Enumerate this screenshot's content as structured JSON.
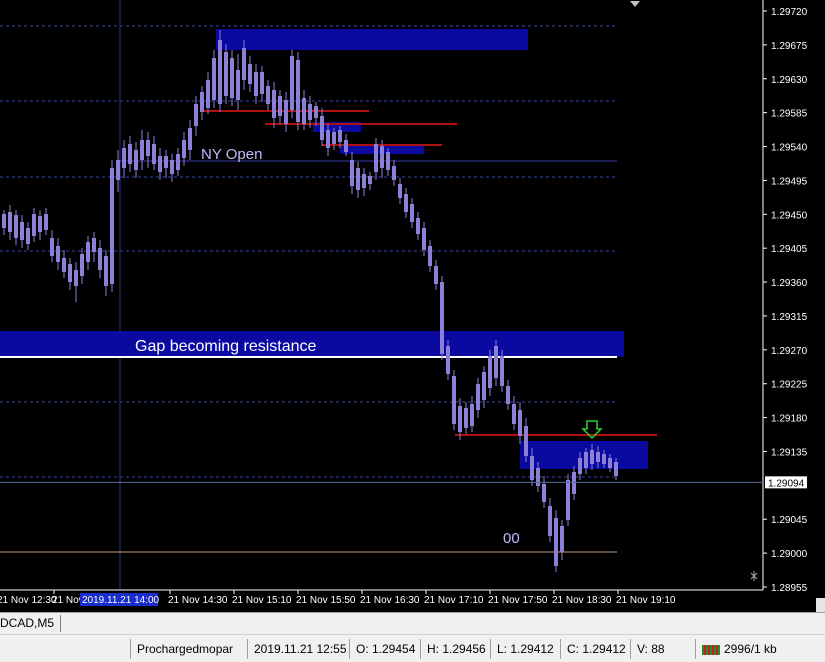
{
  "chart": {
    "background": "#000000",
    "text_color": "#ffffff",
    "price_axis_labels": [
      "1.29720",
      "1.29675",
      "1.29630",
      "1.29585",
      "1.29540",
      "1.29495",
      "1.29450",
      "1.29405",
      "1.29360",
      "1.29315",
      "1.29270",
      "1.29225",
      "1.29180",
      "1.29135",
      "1.29045",
      "1.29000",
      "1.28955"
    ],
    "current_price": "1.29094",
    "time_axis_labels": [
      "21 Nov 12:30",
      "21 Nov 13",
      "21 Nov 14:30",
      "21 Nov 15:10",
      "21 Nov 15:50",
      "21 Nov 16:30",
      "21 Nov 17:10",
      "21 Nov 17:50",
      "21 Nov 18:30",
      "21 Nov 19:10"
    ],
    "time_highlight": "2019.11.21 14:00",
    "annotations": {
      "ny_open": "NY Open",
      "gap": "Gap becoming resistance",
      "round_number": "00"
    },
    "colors": {
      "candle": "#8b7fd6",
      "zone": "#0a0aa0",
      "red_line": "#b01010",
      "grid": "#3a4a9a",
      "arrow": "#2fd02f"
    }
  },
  "tab": {
    "label": "DCAD,M5"
  },
  "status": {
    "profile": "Prochargedmopar",
    "datetime": "2019.11.21 12:55",
    "open": "O: 1.29454",
    "high": "H: 1.29456",
    "low": "L: 1.29412",
    "close": "C: 1.29412",
    "volume": "V: 88",
    "traffic": "2996/1 kb"
  }
}
